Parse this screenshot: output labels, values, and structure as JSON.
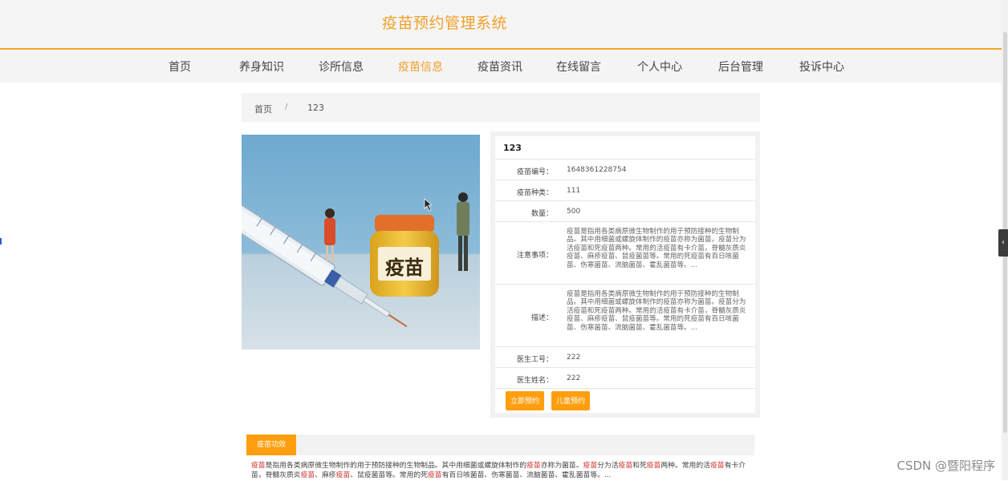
{
  "header": {
    "title": "疫苗预约管理系统",
    "nav": [
      {
        "label": "首页",
        "active": false
      },
      {
        "label": "养身知识",
        "active": false
      },
      {
        "label": "诊所信息",
        "active": false
      },
      {
        "label": "疫苗信息",
        "active": true
      },
      {
        "label": "疫苗资讯",
        "active": false
      },
      {
        "label": "在线留言",
        "active": false
      },
      {
        "label": "个人中心",
        "active": false
      },
      {
        "label": "后台管理",
        "active": false
      },
      {
        "label": "投诉中心",
        "active": false
      }
    ]
  },
  "breadcrumb": {
    "home": "首页",
    "separator": "/",
    "current": "123"
  },
  "product_image": {
    "label_text": "疫苗"
  },
  "detail": {
    "title": "123",
    "fields": {
      "code_label": "疫苗编号：",
      "code_value": "1648361228754",
      "type_label": "疫苗种类：",
      "type_value": "111",
      "quantity_label": "数量：",
      "quantity_value": "500",
      "notes_label": "注意事项：",
      "notes_text": "疫苗是指用各类病原微生物制作的用于预防接种的生物制品。其中用细菌或螺旋体制作的疫苗亦称为菌苗。疫苗分为活疫苗和死疫苗两种。常用的活疫苗有卡介苗，脊髓灰质炎疫苗、麻疹疫苗、鼠疫菌苗等。常用的死疫苗有百日咳菌苗、伤寒菌苗、流脑菌苗、霍乱菌苗等。...",
      "desc_label": "描述：",
      "desc_text": "疫苗是指用各类病原微生物制作的用于预防接种的生物制品。其中用细菌或螺旋体制作的疫苗亦称为菌苗。疫苗分为活疫苗和死疫苗两种。常用的活疫苗有卡介苗，脊髓灰质炎疫苗、麻疹疫苗、鼠疫菌苗等。常用的死疫苗有百日咳菌苗、伤寒菌苗、流脑菌苗、霍乱菌苗等。...",
      "doctor_id_label": "医生工号：",
      "doctor_id_value": "222",
      "doctor_name_label": "医生姓名：",
      "doctor_name_value": "222"
    },
    "buttons": {
      "book_now": "立即预约",
      "child_book": "儿童预约"
    }
  },
  "tabs": {
    "active_label": "疫苗功效",
    "content": [
      {
        "t": "疫苗",
        "hl": true
      },
      {
        "t": "是指用各类病原微生物制作的用于预防接种的生物制品。其中用细菌或螺旋体制作的",
        "hl": false
      },
      {
        "t": "疫苗",
        "hl": true
      },
      {
        "t": "亦称为菌苗。",
        "hl": false
      },
      {
        "t": "疫苗",
        "hl": true
      },
      {
        "t": "分为活",
        "hl": false
      },
      {
        "t": "疫苗",
        "hl": true
      },
      {
        "t": "和死",
        "hl": false
      },
      {
        "t": "疫苗",
        "hl": true
      },
      {
        "t": "两种。常用的活",
        "hl": false
      },
      {
        "t": "疫苗",
        "hl": true
      },
      {
        "t": "有卡介苗，脊髓灰质炎",
        "hl": false
      },
      {
        "t": "疫苗",
        "hl": true
      },
      {
        "t": "、麻疹",
        "hl": false
      },
      {
        "t": "疫苗",
        "hl": true
      },
      {
        "t": "、鼠疫菌苗等。常用的死",
        "hl": false
      },
      {
        "t": "疫苗",
        "hl": true
      },
      {
        "t": "有百日咳菌苗、伤寒菌苗、流脑菌苗、霍乱菌苗等。...",
        "hl": false
      }
    ]
  },
  "watermark": "CSDN @暨阳程序",
  "colors": {
    "accent": "#f5a623",
    "button": "#ff9f10",
    "highlight": "#d0302c"
  }
}
